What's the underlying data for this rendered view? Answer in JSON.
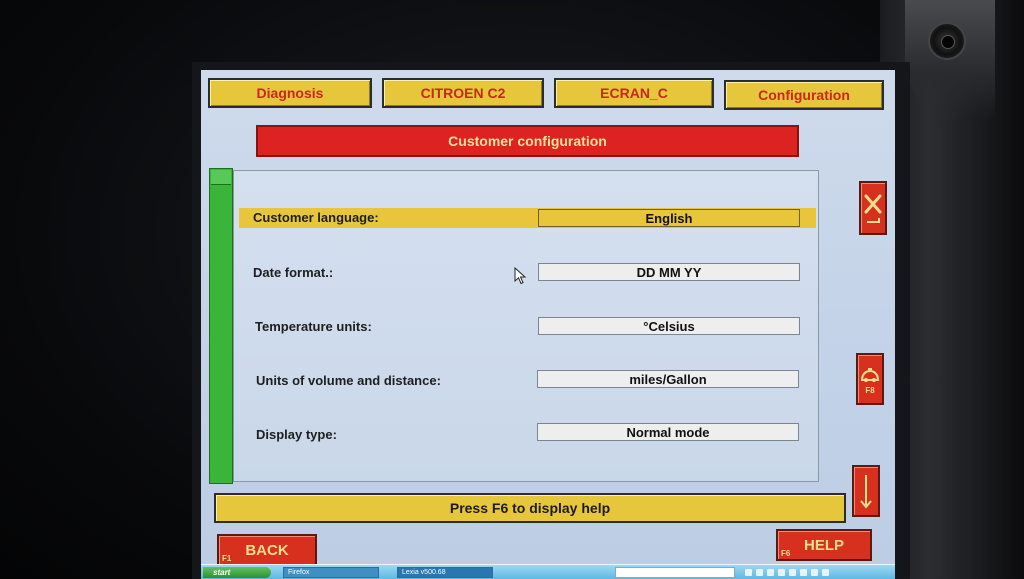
{
  "tabs": [
    {
      "label": "Diagnosis"
    },
    {
      "label": "CITROEN C2"
    },
    {
      "label": "ECRAN_C"
    },
    {
      "label": "Configuration"
    }
  ],
  "banner": {
    "title": "Customer configuration"
  },
  "settings": [
    {
      "label": "Customer language:",
      "value": "English"
    },
    {
      "label": "Date format.:",
      "value": "DD MM YY"
    },
    {
      "label": "Temperature units:",
      "value": "°Celsius"
    },
    {
      "label": "Units of volume and distance:",
      "value": "miles/Gallon"
    },
    {
      "label": "Display type:",
      "value": "Normal mode"
    }
  ],
  "help_bar": {
    "text": "Press F6 to display help"
  },
  "buttons": {
    "back": {
      "label": "BACK",
      "fkey": "F1"
    },
    "help": {
      "label": "HELP",
      "fkey": "F6"
    },
    "side_f8": {
      "fkey": "F8"
    }
  },
  "taskbar": {
    "start_label": "start",
    "items": [
      "Firefox",
      "Lexia v500.68"
    ]
  },
  "colors": {
    "tab_yellow": "#e6c63a",
    "tab_text_red": "#c8281e",
    "banner_red": "#dd2222",
    "selection_yellow": "#e9c53c",
    "progress_green": "#3ab53a",
    "screen_bg": "#c8d6ea"
  }
}
